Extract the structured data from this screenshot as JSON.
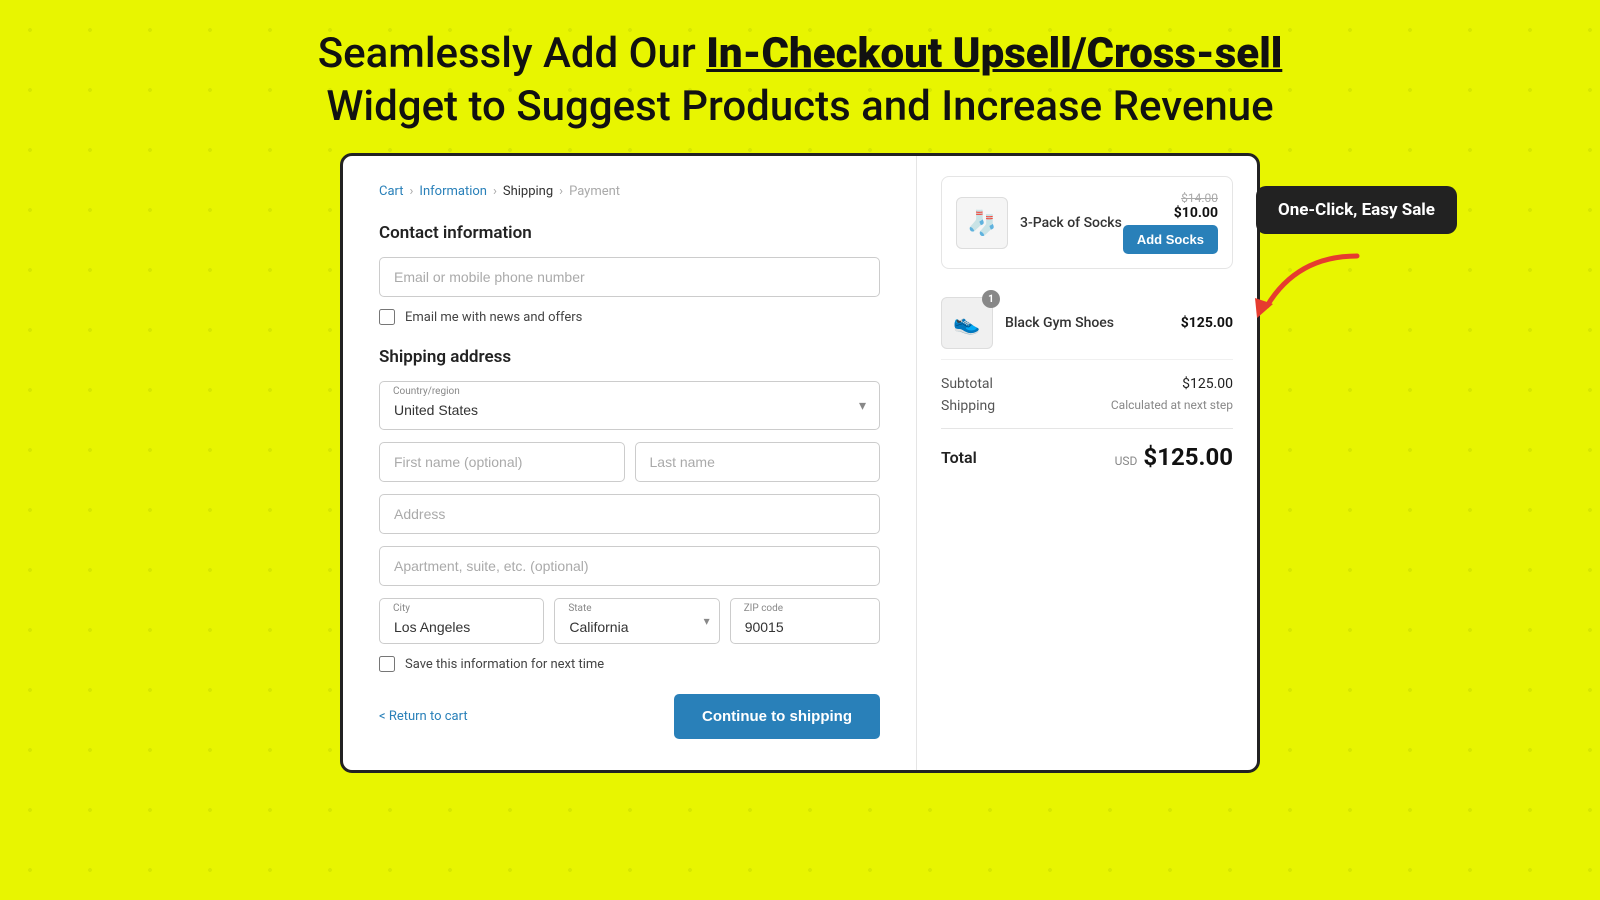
{
  "headline": {
    "line1_prefix": "Seamlessly Add Our ",
    "line1_bold": "In-Checkout Upsell/Cross-sell",
    "line2": "Widget to Suggest Products and Increase Revenue"
  },
  "breadcrumb": {
    "items": [
      "Cart",
      "Information",
      "Shipping",
      "Payment"
    ]
  },
  "contact": {
    "title": "Contact information",
    "email_placeholder": "Email or mobile phone number",
    "checkbox_label": "Email me with news and offers"
  },
  "shipping": {
    "title": "Shipping address",
    "country_label": "Country/region",
    "country_value": "United States",
    "first_name_placeholder": "First name (optional)",
    "last_name_placeholder": "Last name",
    "address_placeholder": "Address",
    "apt_placeholder": "Apartment, suite, etc. (optional)",
    "city_label": "City",
    "city_value": "Los Angeles",
    "state_label": "State",
    "state_value": "California",
    "zip_label": "ZIP code",
    "zip_value": "90015",
    "save_label": "Save this information for next time"
  },
  "footer": {
    "return_label": "< Return to cart",
    "continue_label": "Continue to shipping"
  },
  "order": {
    "upsell_product": {
      "name": "3-Pack of Socks",
      "price_old": "$14.00",
      "price_new": "$10.00",
      "add_label": "Add Socks",
      "emoji": "🧦"
    },
    "main_product": {
      "name": "Black Gym Shoes",
      "price": "$125.00",
      "badge": "1",
      "emoji": "👟"
    },
    "subtotal_label": "Subtotal",
    "subtotal_value": "$125.00",
    "shipping_label": "Shipping",
    "shipping_value": "Calculated at next step",
    "total_label": "Total",
    "total_currency": "USD",
    "total_amount": "$125.00"
  },
  "callout": {
    "text": "One-Click, Easy Sale"
  }
}
